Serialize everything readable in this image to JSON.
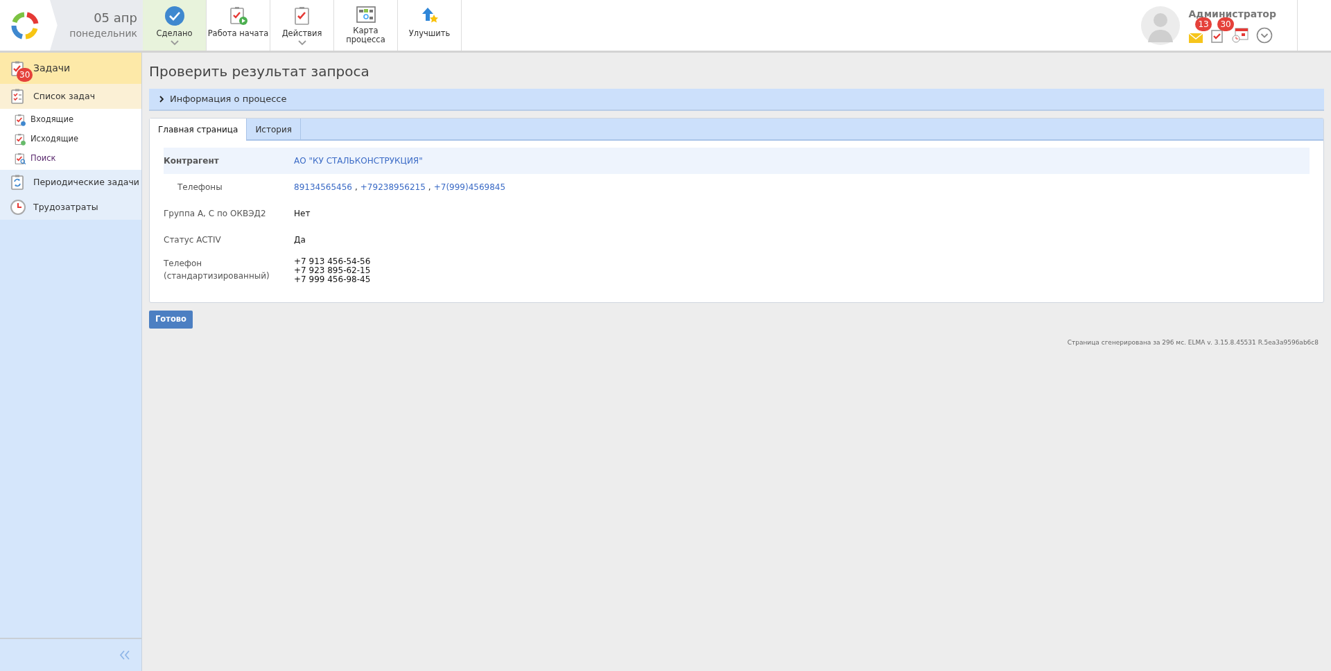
{
  "header": {
    "date": "05 апр",
    "weekday": "понедельник",
    "toolbar": [
      {
        "label": "Сделано",
        "kind": "done",
        "selected": true,
        "dropdown": true
      },
      {
        "label": "Работа начата",
        "kind": "start",
        "selected": false,
        "dropdown": false
      },
      {
        "label": "Действия",
        "kind": "actions",
        "selected": false,
        "dropdown": true
      },
      {
        "label": "Карта процесса",
        "kind": "map",
        "selected": false,
        "dropdown": false
      },
      {
        "label": "Улучшить",
        "kind": "improve",
        "selected": false,
        "dropdown": false
      }
    ],
    "user": {
      "name": "Администратор",
      "notifications": [
        {
          "kind": "mail",
          "badge": "13"
        },
        {
          "kind": "tasks",
          "badge": "30"
        },
        {
          "kind": "calendar"
        },
        {
          "kind": "menu"
        }
      ]
    }
  },
  "sidebar": {
    "header": {
      "label": "Задачи",
      "badge": "30"
    },
    "items": [
      {
        "label": "Список задач",
        "kind": "list",
        "selected": true,
        "children": [
          {
            "label": "Входящие",
            "kind": "incoming"
          },
          {
            "label": "Исходящие",
            "kind": "outgoing"
          },
          {
            "label": "Поиск",
            "kind": "search"
          }
        ]
      },
      {
        "label": "Периодические задачи",
        "kind": "periodic",
        "selected": false
      },
      {
        "label": "Трудозатраты",
        "kind": "time",
        "selected": false
      }
    ]
  },
  "page": {
    "title": "Проверить результат запроса",
    "process_info": {
      "label": "Информация о процессе",
      "expanded": false
    },
    "tabs": [
      {
        "label": "Главная страница",
        "selected": true
      },
      {
        "label": "История",
        "selected": false
      }
    ],
    "fields": [
      {
        "label": "Контрагент",
        "kind": "link",
        "highlighted": true,
        "indented": false,
        "values": [
          "АО \"КУ СТАЛЬКОНСТРУКЦИЯ\""
        ]
      },
      {
        "label": "Телефоны",
        "kind": "link",
        "separator": ",",
        "highlighted": false,
        "indented": true,
        "values": [
          "89134565456",
          "+79238956215",
          "+7(999)4569845"
        ]
      },
      {
        "label": "Группа А, С по ОКВЭД2",
        "kind": "text",
        "highlighted": false,
        "indented": false,
        "values": [
          "Нет"
        ]
      },
      {
        "label": "Статус ACTIV",
        "kind": "text",
        "highlighted": false,
        "indented": false,
        "values": [
          "Да"
        ]
      },
      {
        "label": "Телефон (стандартизированный)",
        "kind": "lines",
        "highlighted": false,
        "indented": false,
        "values": [
          "+7 913 456-54-56",
          "+7 923 895-62-15",
          "+7 999 456-98-45"
        ]
      }
    ],
    "submit": "Готово",
    "footer": "Страница сгенерирована за 296 мс. ELMA v. 3.15.8.45531 R.5ea3a9596ab6c8"
  }
}
